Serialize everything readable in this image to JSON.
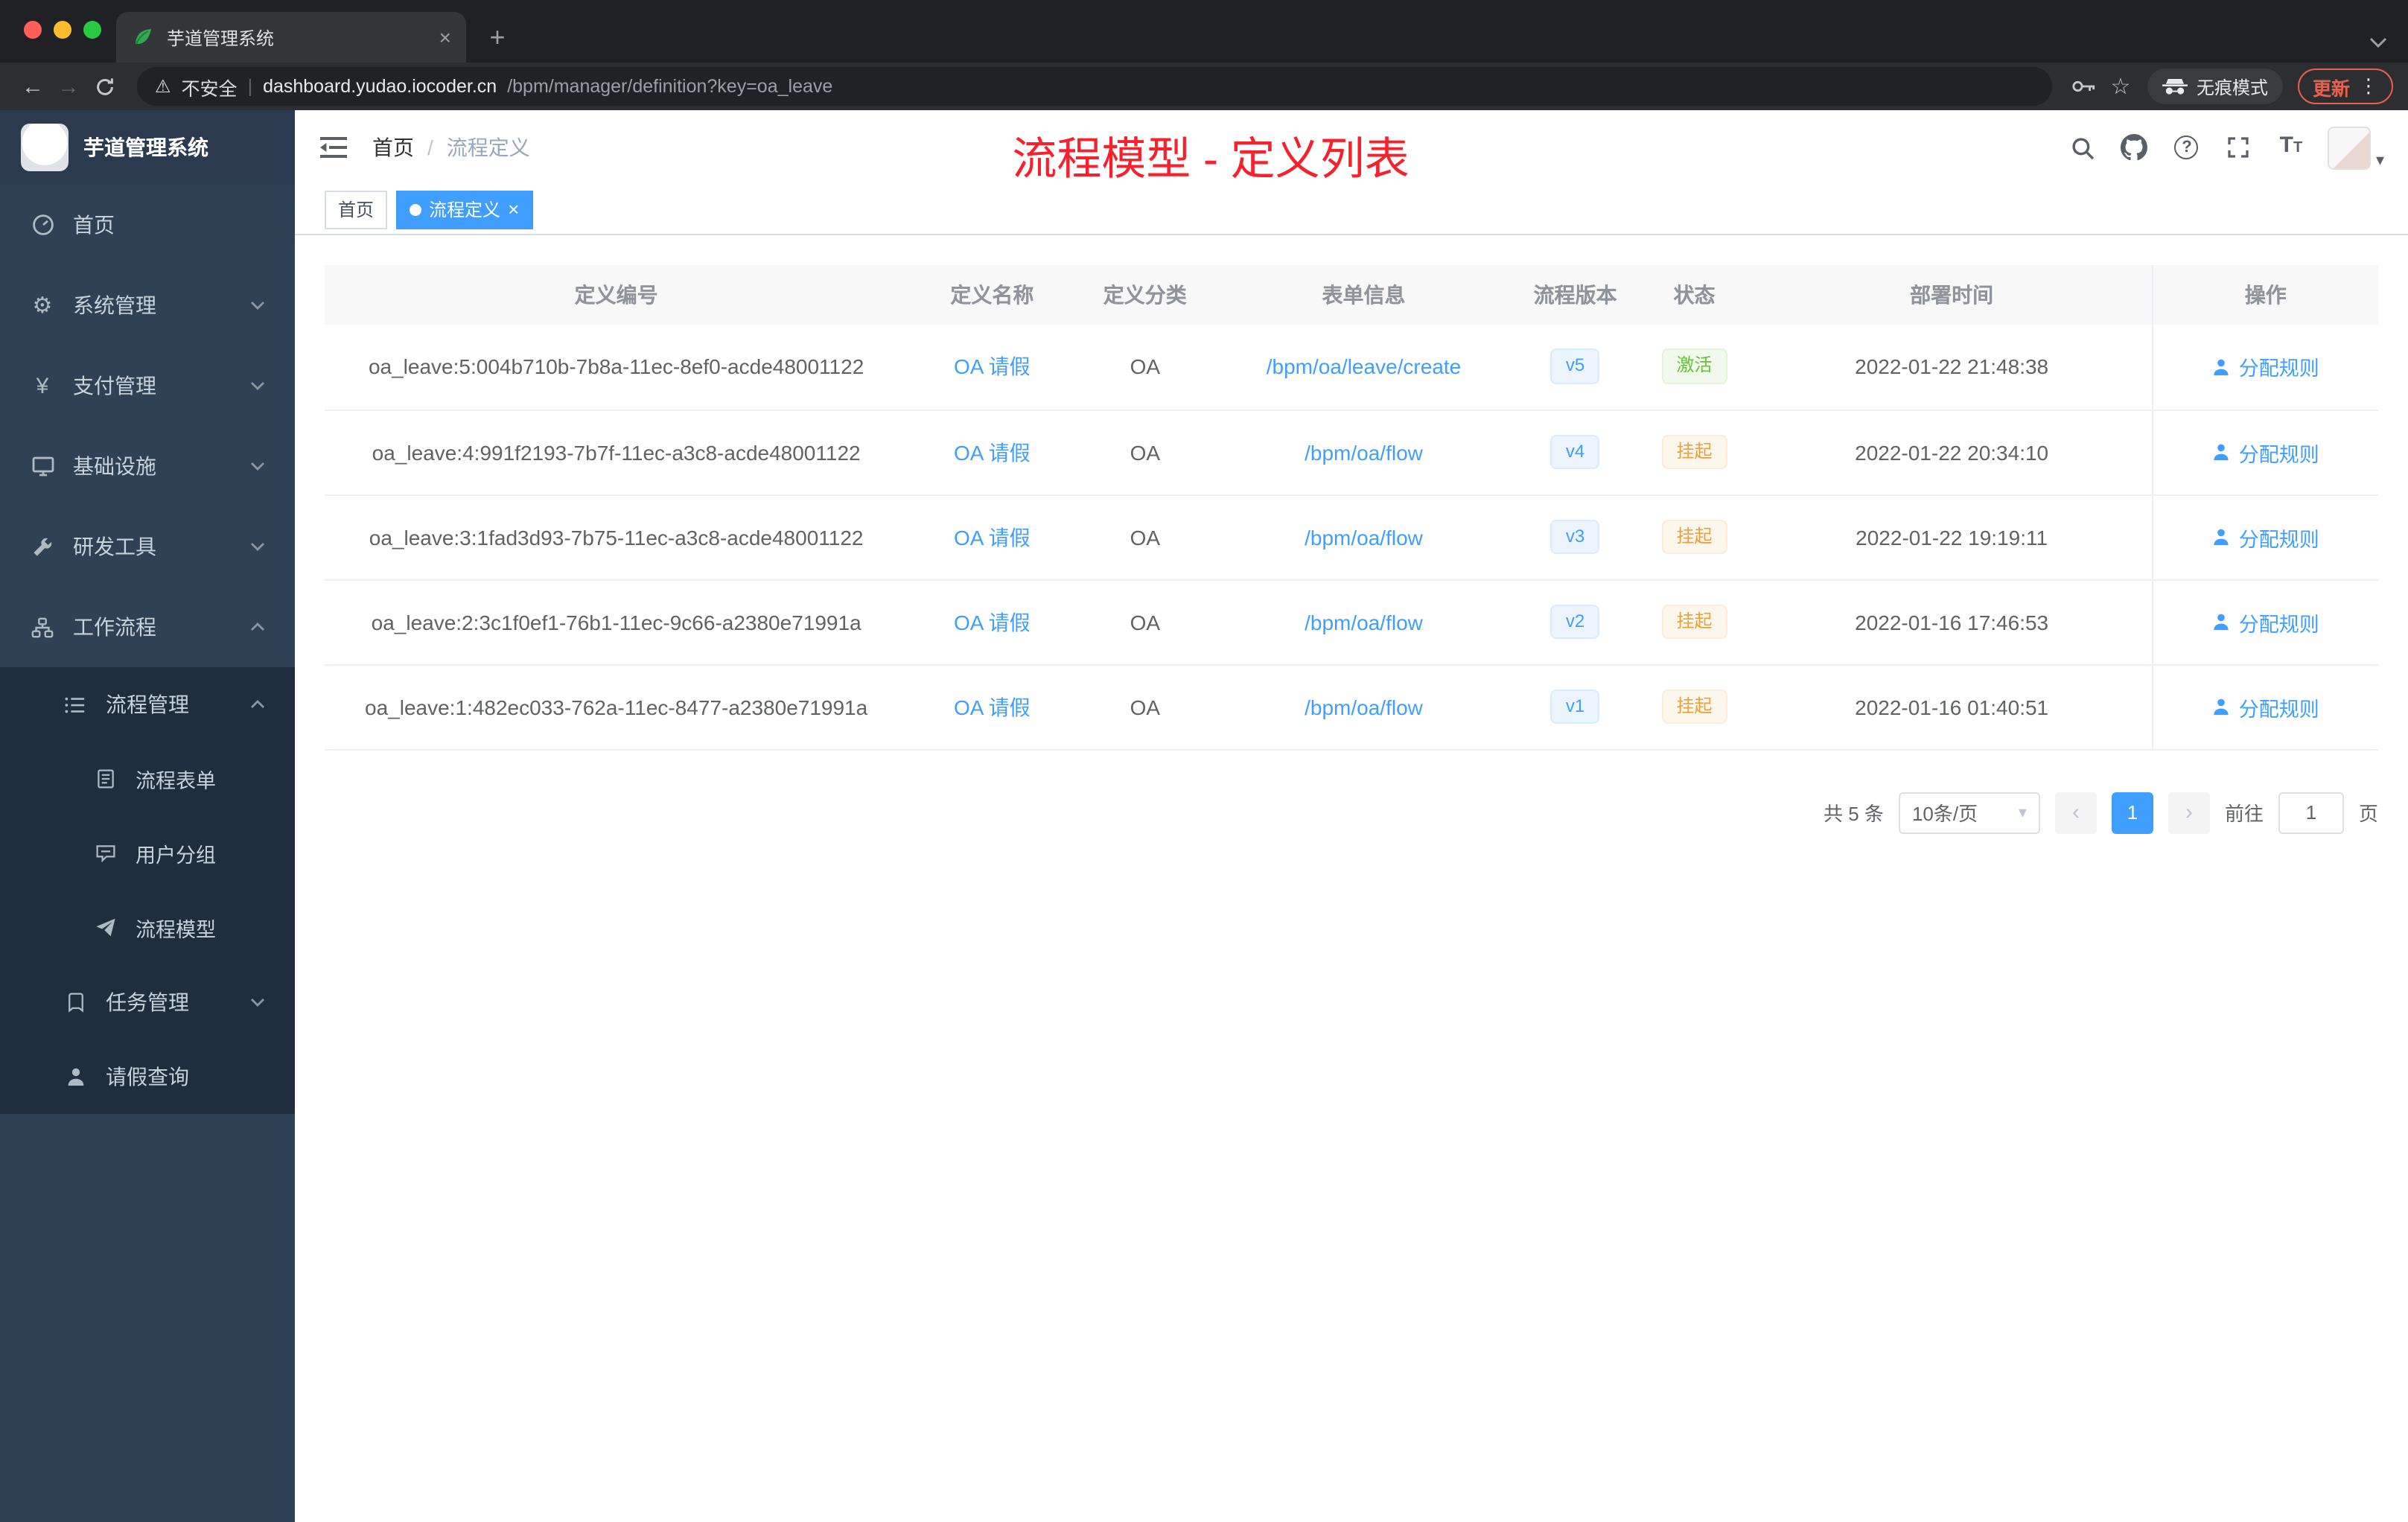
{
  "colors": {
    "accent": "#409eff",
    "success": "#67c23a",
    "warning": "#e6a23c",
    "annotation_red": "#f5222d",
    "sidebar_bg": "#304156",
    "submenu_bg": "#1f2d3d"
  },
  "icons": {
    "close": "×",
    "plus": "+",
    "caret_down": "▾",
    "chevron_left": "‹",
    "chevron_right": "›",
    "more_vert": "⋮",
    "back": "←",
    "forward": "→",
    "star": "☆",
    "warning": "⚠",
    "breadcrumb_separator": "/",
    "url_separator": "|",
    "help": "?",
    "yen": "¥",
    "gear": "⚙",
    "font_large": "T",
    "font_small": "T"
  },
  "browser": {
    "tab_title": "芋道管理系统",
    "security_label": "不安全",
    "url_host": "dashboard.yudao.iocoder.cn",
    "url_path": "/bpm/manager/definition?key=oa_leave",
    "incognito_label": "无痕模式",
    "update_label": "更新"
  },
  "sidebar": {
    "logo_title": "芋道管理系统",
    "menu": {
      "home": "首页",
      "system": "系统管理",
      "payment": "支付管理",
      "infrastructure": "基础设施",
      "devtools": "研发工具",
      "workflow": "工作流程",
      "process_management": "流程管理",
      "process_form": "流程表单",
      "user_group": "用户分组",
      "process_model": "流程模型",
      "task_management": "任务管理",
      "leave_query": "请假查询"
    }
  },
  "header": {
    "breadcrumb_home": "首页",
    "breadcrumb_current": "流程定义",
    "annotation": "流程模型 - 定义列表"
  },
  "tags": {
    "home": "首页",
    "current": "流程定义"
  },
  "table": {
    "columns": [
      "定义编号",
      "定义名称",
      "定义分类",
      "表单信息",
      "流程版本",
      "状态",
      "部署时间",
      "操作"
    ],
    "rows": [
      {
        "id": "oa_leave:5:004b710b-7b8a-11ec-8ef0-acde48001122",
        "name": "OA 请假",
        "category": "OA",
        "form": "/bpm/oa/leave/create",
        "version": "v5",
        "status": "激活",
        "status_type": "success",
        "deploy_time": "2022-01-22 21:48:38",
        "action": "分配规则"
      },
      {
        "id": "oa_leave:4:991f2193-7b7f-11ec-a3c8-acde48001122",
        "name": "OA 请假",
        "category": "OA",
        "form": "/bpm/oa/flow",
        "version": "v4",
        "status": "挂起",
        "status_type": "warning",
        "deploy_time": "2022-01-22 20:34:10",
        "action": "分配规则"
      },
      {
        "id": "oa_leave:3:1fad3d93-7b75-11ec-a3c8-acde48001122",
        "name": "OA 请假",
        "category": "OA",
        "form": "/bpm/oa/flow",
        "version": "v3",
        "status": "挂起",
        "status_type": "warning",
        "deploy_time": "2022-01-22 19:19:11",
        "action": "分配规则"
      },
      {
        "id": "oa_leave:2:3c1f0ef1-76b1-11ec-9c66-a2380e71991a",
        "name": "OA 请假",
        "category": "OA",
        "form": "/bpm/oa/flow",
        "version": "v2",
        "status": "挂起",
        "status_type": "warning",
        "deploy_time": "2022-01-16 17:46:53",
        "action": "分配规则"
      },
      {
        "id": "oa_leave:1:482ec033-762a-11ec-8477-a2380e71991a",
        "name": "OA 请假",
        "category": "OA",
        "form": "/bpm/oa/flow",
        "version": "v1",
        "status": "挂起",
        "status_type": "warning",
        "deploy_time": "2022-01-16 01:40:51",
        "action": "分配规则"
      }
    ]
  },
  "pagination": {
    "total": "共 5 条",
    "page_size": "10条/页",
    "current_page": "1",
    "goto_label": "前往",
    "goto_value": "1",
    "page_unit": "页"
  }
}
